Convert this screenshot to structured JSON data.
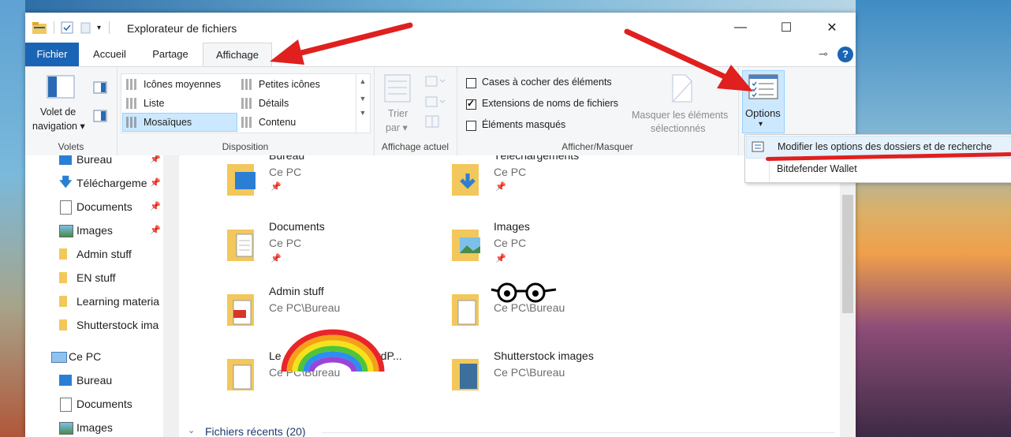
{
  "window": {
    "title": "Explorateur de fichiers",
    "controls": {
      "minimize": "—",
      "maximize": "☐",
      "close": "✕"
    },
    "help": "?"
  },
  "tabs": [
    {
      "label": "Fichier"
    },
    {
      "label": "Accueil"
    },
    {
      "label": "Partage"
    },
    {
      "label": "Affichage"
    }
  ],
  "ribbon": {
    "volets": {
      "label": "Volets",
      "nav_button_line1": "Volet de",
      "nav_button_line2": "navigation ▾"
    },
    "disposition": {
      "label": "Disposition",
      "items": [
        {
          "label": "Icônes moyennes"
        },
        {
          "label": "Petites icônes"
        },
        {
          "label": "Liste"
        },
        {
          "label": "Détails"
        },
        {
          "label": "Mosaïques"
        },
        {
          "label": "Contenu"
        }
      ]
    },
    "affichage_actuel": {
      "label": "Affichage actuel",
      "sort_line1": "Trier",
      "sort_line2": "par ▾"
    },
    "afficher_masquer": {
      "label": "Afficher/Masquer",
      "checkboxes": [
        {
          "label": "Cases à cocher des éléments",
          "checked": false
        },
        {
          "label": "Extensions de noms de fichiers",
          "checked": true
        },
        {
          "label": "Éléments masqués",
          "checked": false
        }
      ],
      "hide_line1": "Masquer les éléments",
      "hide_line2": "sélectionnés"
    },
    "options": {
      "label": "Options",
      "caret": "▾"
    }
  },
  "options_menu": [
    {
      "label": "Modifier les options des dossiers et de recherche"
    },
    {
      "label": "Bitdefender Wallet"
    }
  ],
  "nav": {
    "items": [
      {
        "label": "Bureau"
      },
      {
        "label": "Téléchargeme"
      },
      {
        "label": "Documents"
      },
      {
        "label": "Images"
      },
      {
        "label": "Admin stuff"
      },
      {
        "label": "EN stuff"
      },
      {
        "label": "Learning materia"
      },
      {
        "label": "Shutterstock ima"
      },
      {
        "label": "Ce PC"
      },
      {
        "label": "Bureau"
      },
      {
        "label": "Documents"
      },
      {
        "label": "Images"
      }
    ]
  },
  "content": {
    "tiles": [
      {
        "name": "Bureau",
        "sub": "Ce PC"
      },
      {
        "name": "Téléchargements",
        "sub": "Ce PC"
      },
      {
        "name": "Documents",
        "sub": "Ce PC"
      },
      {
        "name": "Images",
        "sub": "Ce PC"
      },
      {
        "name": "Admin stuff",
        "sub": "Ce PC\\Bureau"
      },
      {
        "name": "",
        "sub": "Ce PC\\Bureau"
      },
      {
        "name": "Le",
        "name_tail": "rdP...",
        "sub": "Ce PC\\Bureau"
      },
      {
        "name": "Shutterstock images",
        "sub": "Ce PC\\Bureau"
      }
    ],
    "recent_header": "Fichiers récents (20)"
  },
  "colors": {
    "file_tab": "#1a64b5",
    "selection": "#cce8ff",
    "annotation": "#e01f1f",
    "folder": "#f2c75c"
  }
}
